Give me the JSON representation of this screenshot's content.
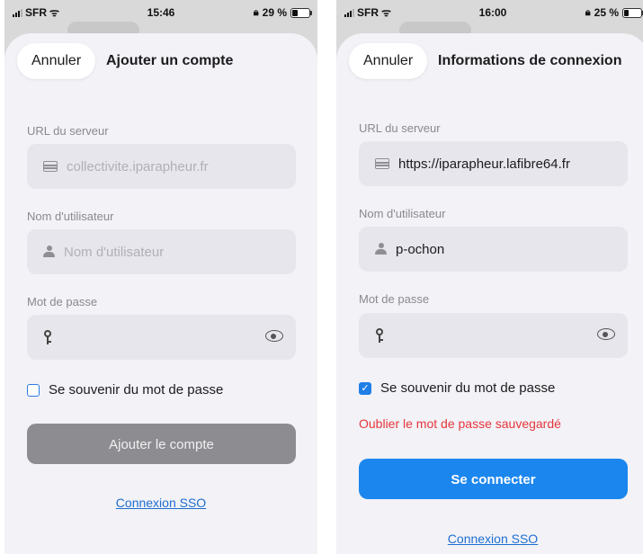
{
  "left": {
    "status": {
      "carrier": "SFR",
      "time": "15:46",
      "battery_text": "29 %",
      "battery_level": 0.29
    },
    "nav": {
      "cancel": "Annuler",
      "title": "Ajouter un compte"
    },
    "server": {
      "label": "URL du serveur",
      "placeholder": "collectivite.iparapheur.fr"
    },
    "username": {
      "label": "Nom d'utilisateur",
      "placeholder": "Nom d'utilisateur"
    },
    "password": {
      "label": "Mot de passe",
      "value": ""
    },
    "remember": {
      "label": "Se souvenir du mot de passe",
      "checked": false
    },
    "submit_label": "Ajouter le compte",
    "sso_label": "Connexion SSO"
  },
  "right": {
    "status": {
      "carrier": "SFR",
      "time": "16:00",
      "battery_text": "25 %",
      "battery_level": 0.25
    },
    "nav": {
      "cancel": "Annuler",
      "title": "Informations de connexion"
    },
    "server": {
      "label": "URL du serveur",
      "value": "https://iparapheur.lafibre64.fr"
    },
    "username": {
      "label": "Nom d'utilisateur",
      "value": "p-ochon"
    },
    "password": {
      "label": "Mot de passe",
      "value": ""
    },
    "remember": {
      "label": "Se souvenir du mot de passe",
      "checked": true
    },
    "forget_label": "Oublier le mot de passe sauvegardé",
    "submit_label": "Se connecter",
    "sso_label": "Connexion SSO"
  },
  "colors": {
    "primary": "#1b86ee",
    "disabled": "#8d8d91",
    "danger": "#e5363b",
    "link": "#1f6fcf"
  },
  "icons": [
    "server-icon",
    "person-icon",
    "key-icon",
    "eye-icon",
    "checkbox",
    "wifi-icon",
    "battery-icon"
  ]
}
